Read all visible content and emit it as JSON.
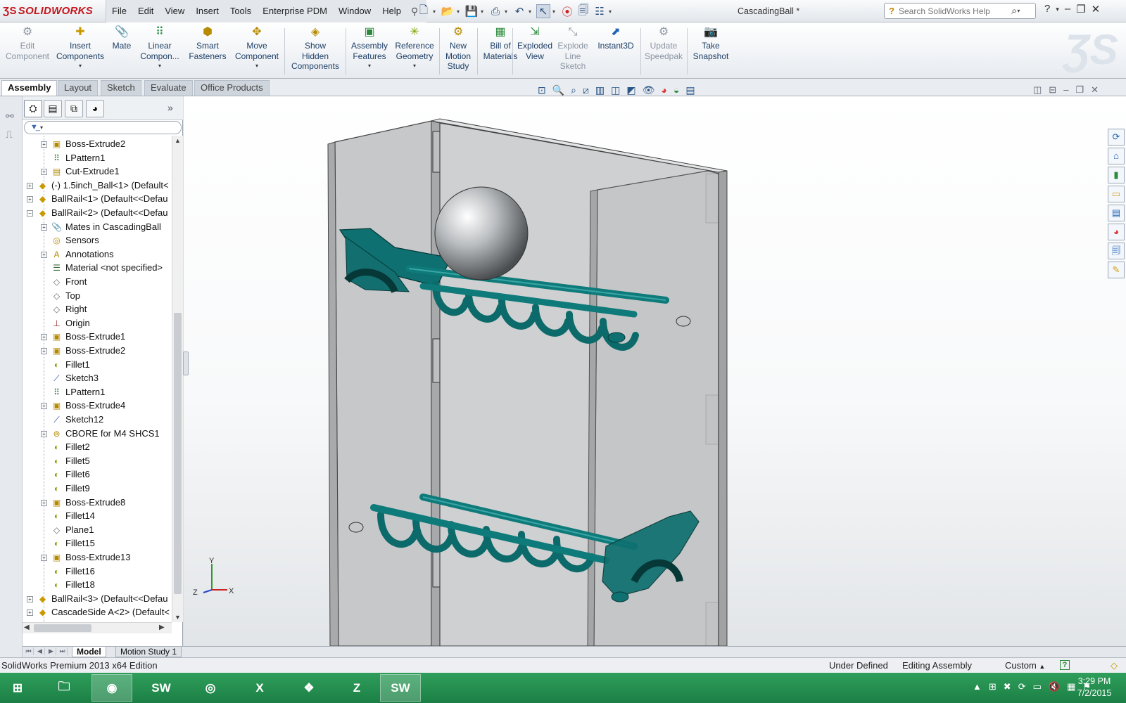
{
  "app": {
    "brand": "SOLIDWORKS",
    "document_title": "CascadingBall *",
    "accent": "#c3161c"
  },
  "menu": [
    "File",
    "Edit",
    "View",
    "Insert",
    "Tools",
    "Enterprise PDM",
    "Window",
    "Help"
  ],
  "search": {
    "placeholder": "Search SolidWorks Help"
  },
  "ribbon": {
    "edit_component": "Edit\nComponent",
    "insert_components": "Insert\nComponents",
    "mate": "Mate",
    "linear_component": "Linear\nCompon...",
    "smart_fasteners": "Smart\nFasteners",
    "move_component": "Move\nComponent",
    "show_hidden": "Show\nHidden\nComponents",
    "assembly_features": "Assembly\nFeatures",
    "reference_geometry": "Reference\nGeometry",
    "new_motion_study": "New\nMotion\nStudy",
    "bill_of_materials": "Bill of\nMaterials",
    "exploded_view": "Exploded\nView",
    "explode_line_sketch": "Explode\nLine\nSketch",
    "instant3d": "Instant3D",
    "update_speedpak": "Update\nSpeedpak",
    "take_snapshot": "Take\nSnapshot"
  },
  "command_tabs": [
    "Assembly",
    "Layout",
    "Sketch",
    "Evaluate",
    "Office Products"
  ],
  "tree": {
    "items": [
      {
        "label": "Boss-Extrude2",
        "level": 1,
        "exp": true,
        "icon": "extrude-feature"
      },
      {
        "label": "LPattern1",
        "level": 1,
        "exp": false,
        "icon": "linear-pattern"
      },
      {
        "label": "Cut-Extrude1",
        "level": 1,
        "exp": true,
        "icon": "cut-feature"
      },
      {
        "label": "(-) 1.5inch_Ball<1> (Default<",
        "level": 0,
        "exp": true,
        "icon": "part"
      },
      {
        "label": "BallRail<1> (Default<<Defau",
        "level": 0,
        "exp": true,
        "icon": "part"
      },
      {
        "label": "BallRail<2> (Default<<Defau",
        "level": 0,
        "exp": true,
        "expanded": true,
        "icon": "part"
      },
      {
        "label": "Mates in CascadingBall",
        "level": 1,
        "exp": true,
        "icon": "mates"
      },
      {
        "label": "Sensors",
        "level": 1,
        "exp": false,
        "icon": "sensor"
      },
      {
        "label": "Annotations",
        "level": 1,
        "exp": true,
        "icon": "annotation"
      },
      {
        "label": "Material <not specified>",
        "level": 1,
        "exp": false,
        "icon": "material"
      },
      {
        "label": "Front",
        "level": 1,
        "exp": false,
        "icon": "plane"
      },
      {
        "label": "Top",
        "level": 1,
        "exp": false,
        "icon": "plane"
      },
      {
        "label": "Right",
        "level": 1,
        "exp": false,
        "icon": "plane"
      },
      {
        "label": "Origin",
        "level": 1,
        "exp": false,
        "icon": "origin"
      },
      {
        "label": "Boss-Extrude1",
        "level": 1,
        "exp": true,
        "icon": "extrude-feature"
      },
      {
        "label": "Boss-Extrude2",
        "level": 1,
        "exp": true,
        "icon": "extrude-feature"
      },
      {
        "label": "Fillet1",
        "level": 1,
        "exp": false,
        "icon": "fillet"
      },
      {
        "label": "Sketch3",
        "level": 1,
        "exp": false,
        "icon": "sketch"
      },
      {
        "label": "LPattern1",
        "level": 1,
        "exp": false,
        "icon": "linear-pattern"
      },
      {
        "label": "Boss-Extrude4",
        "level": 1,
        "exp": true,
        "icon": "extrude-feature"
      },
      {
        "label": "Sketch12",
        "level": 1,
        "exp": false,
        "icon": "sketch"
      },
      {
        "label": "CBORE for M4 SHCS1",
        "level": 1,
        "exp": true,
        "icon": "hole"
      },
      {
        "label": "Fillet2",
        "level": 1,
        "exp": false,
        "icon": "fillet"
      },
      {
        "label": "Fillet5",
        "level": 1,
        "exp": false,
        "icon": "fillet"
      },
      {
        "label": "Fillet6",
        "level": 1,
        "exp": false,
        "icon": "fillet"
      },
      {
        "label": "Fillet9",
        "level": 1,
        "exp": false,
        "icon": "fillet"
      },
      {
        "label": "Boss-Extrude8",
        "level": 1,
        "exp": true,
        "icon": "extrude-feature"
      },
      {
        "label": "Fillet14",
        "level": 1,
        "exp": false,
        "icon": "fillet"
      },
      {
        "label": "Plane1",
        "level": 1,
        "exp": false,
        "icon": "plane"
      },
      {
        "label": "Fillet15",
        "level": 1,
        "exp": false,
        "icon": "fillet"
      },
      {
        "label": "Boss-Extrude13",
        "level": 1,
        "exp": true,
        "icon": "extrude-feature"
      },
      {
        "label": "Fillet16",
        "level": 1,
        "exp": false,
        "icon": "fillet"
      },
      {
        "label": "Fillet18",
        "level": 1,
        "exp": false,
        "icon": "fillet"
      },
      {
        "label": "BallRail<3> (Default<<Defau",
        "level": 0,
        "exp": true,
        "icon": "part"
      },
      {
        "label": "CascadeSide A<2> (Default<",
        "level": 0,
        "exp": true,
        "icon": "part"
      }
    ]
  },
  "triad": {
    "x": "X",
    "y": "Y",
    "z": "Z"
  },
  "bottom_tabs": [
    "Model",
    "Motion Study 1"
  ],
  "status": {
    "edition": "SolidWorks Premium 2013 x64 Edition",
    "defined": "Under Defined",
    "mode": "Editing Assembly",
    "units": "Custom"
  },
  "taskbar": {
    "time": "3:29 PM",
    "date": "7/2/2015",
    "color": "#1f8a4c"
  }
}
